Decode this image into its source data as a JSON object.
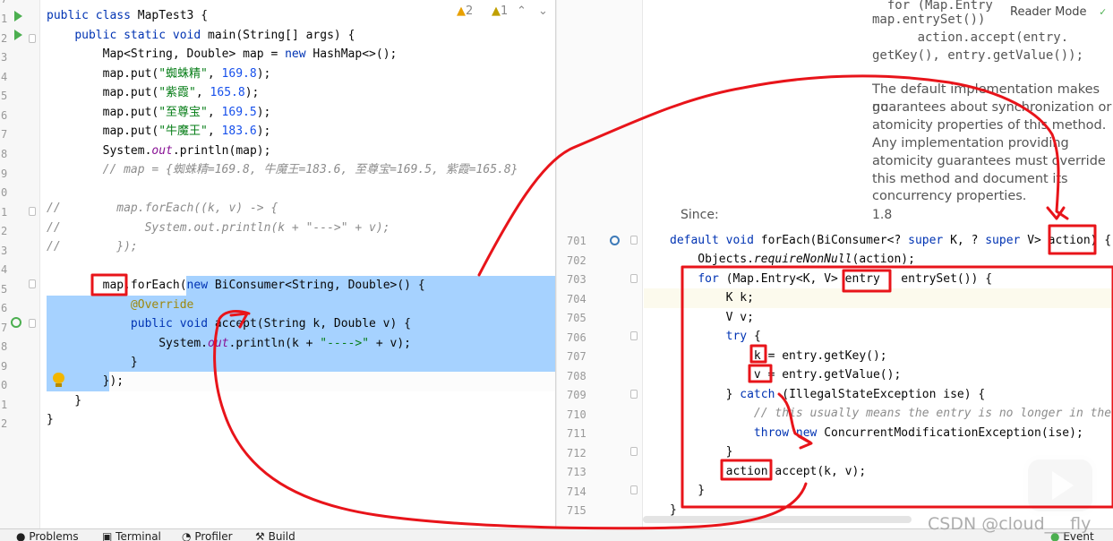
{
  "left_editor": {
    "line_numbers": [
      "7",
      "1",
      "2",
      "3",
      "4",
      "5",
      "6",
      "7",
      "8",
      "9",
      "0",
      "1",
      "2",
      "3",
      "4",
      "5",
      "6",
      "7",
      "8",
      "9",
      "0",
      "1",
      "2"
    ],
    "lines": [
      "public class MapTest3 {",
      "    public static void main(String[] args) {",
      "        Map<String, Double> map = new HashMap<>();",
      "        map.put(\"蜘蛛精\", 169.8);",
      "        map.put(\"紫霞\", 165.8);",
      "        map.put(\"至尊宝\", 169.5);",
      "        map.put(\"牛魔王\", 183.6);",
      "        System.out.println(map);",
      "        // map = {蜘蛛精=169.8, 牛魔王=183.6, 至尊宝=169.5, 紫霞=165.8}",
      "",
      "//        map.forEach((k, v) -> {",
      "//            System.out.println(k + \"--->\" + v);",
      "//        });",
      "",
      "        map.forEach(new BiConsumer<String, Double>() {",
      "            @Override",
      "            public void accept(String k, Double v) {",
      "                System.out.println(k + \"---->\" + v);",
      "            }",
      "        });",
      "    }",
      "}"
    ],
    "warnings": {
      "warn_count": "2",
      "weak_count": "1"
    }
  },
  "right_editor": {
    "reader_mode": "Reader Mode",
    "doc_code": [
      "  for (Map.Entry",
      "map.entrySet())",
      "      action.accept(entry.",
      "getKey(), entry.getValue());"
    ],
    "doc_text": [
      "The default implementation makes no",
      "guarantees about synchronization or",
      "atomicity properties of this method.",
      "Any implementation providing",
      "atomicity guarantees must override",
      "this method and document its",
      "concurrency properties."
    ],
    "since_label": "Since:",
    "since_value": "1.8",
    "line_numbers": [
      "701",
      "702",
      "703",
      "704",
      "705",
      "706",
      "707",
      "708",
      "709",
      "710",
      "711",
      "712",
      "713",
      "714",
      "715"
    ],
    "lines": [
      "default void forEach(BiConsumer<? super K, ? super V> action) {",
      "    Objects.requireNonNull(action);",
      "    for (Map.Entry<K, V> entry : entrySet()) {",
      "        K k;",
      "        V v;",
      "        try {",
      "            k = entry.getKey();",
      "            v = entry.getValue();",
      "        } catch (IllegalStateException ise) {",
      "            // this usually means the entry is no longer in the",
      "            throw new ConcurrentModificationException(ise);",
      "        }",
      "        action.accept(k, v);",
      "    }",
      "}"
    ]
  },
  "statusbar": {
    "problems": "Problems",
    "terminal": "Terminal",
    "profiler": "Profiler",
    "build": "Build",
    "event_log": "Event Log"
  },
  "watermark": "CSDN @cloud___fly",
  "colors": {
    "annotation_red": "#e8141a",
    "selection": "#a6d2ff",
    "keyword": "#0033b3",
    "number": "#1750eb",
    "string": "#067d17",
    "comment": "#8c8c8c"
  }
}
